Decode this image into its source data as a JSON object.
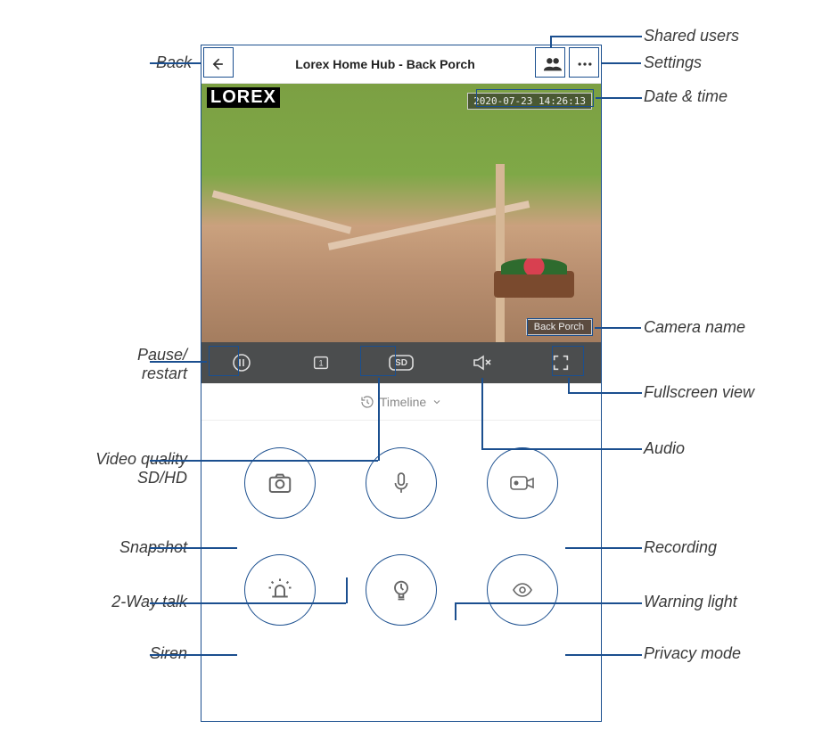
{
  "header": {
    "title": "Lorex Home Hub - Back Porch"
  },
  "video": {
    "logo_text": "LOREX",
    "datetime": "2020-07-23 14:26:13",
    "camera_name": "Back Porch"
  },
  "controlbar": {
    "quality_label": "SD"
  },
  "timeline": {
    "label": "Timeline"
  },
  "callouts": {
    "back": "Back",
    "shared_users": "Shared users",
    "settings": "Settings",
    "date_time": "Date & time",
    "camera_name": "Camera name",
    "pause_restart": "Pause/\nrestart",
    "fullscreen": "Fullscreen view",
    "audio": "Audio",
    "video_quality": "Video quality\nSD/HD",
    "snapshot": "Snapshot",
    "recording": "Recording",
    "twoway": "2-Way talk",
    "warning_light": "Warning light",
    "siren": "Siren",
    "privacy": "Privacy mode"
  },
  "colors": {
    "accent": "#1b4f8f"
  }
}
